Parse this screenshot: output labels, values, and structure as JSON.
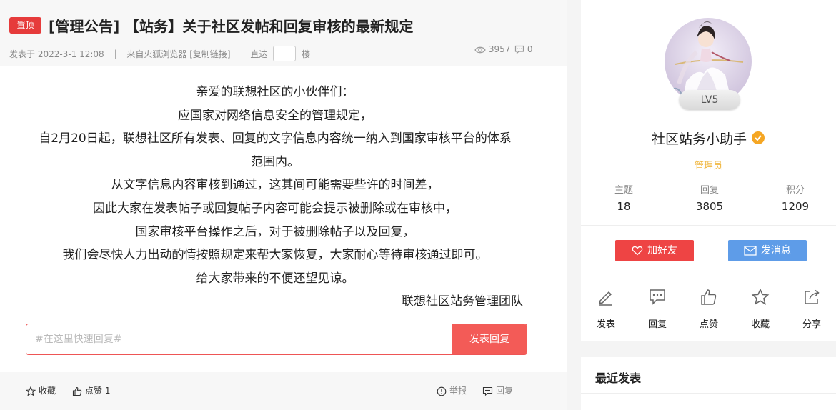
{
  "post": {
    "pin_label": "置顶",
    "title": "[管理公告] 【站务】关于社区发帖和回复审核的最新规定",
    "posted_at": "发表于 2022-3-1 12:08",
    "source": "来自火狐浏览器 [复制链接]",
    "jump_prefix": "直达",
    "jump_suffix": "楼",
    "views": "3957",
    "comments": "0",
    "body_lines": [
      "亲爱的联想社区的小伙伴们：",
      "应国家对网络信息安全的管理规定，",
      "自2月20日起，联想社区所有发表、回复的文字信息内容统一纳入到国家审核平台的体系",
      "范围内。",
      "从文字信息内容审核到通过，这其间可能需要些许的时间差，",
      "因此大家在发表帖子或回复帖子内容可能会提示被删除或在审核中，",
      "国家审核平台操作之后，对于被删除帖子以及回复，",
      "我们会尽快人力出动酌情按照规定来帮大家恢复，大家耐心等待审核通过即可。",
      "给大家带来的不便还望见谅。"
    ],
    "signature": "联想社区站务管理团队"
  },
  "reply": {
    "placeholder": "#在这里快速回复#",
    "button": "发表回复"
  },
  "footer": {
    "collect": "收藏",
    "like": "点赞 1",
    "report": "举报",
    "reply": "回复"
  },
  "profile": {
    "level": "LV5",
    "name": "社区站务小助手",
    "role": "管理员",
    "stats": [
      {
        "label": "主题",
        "value": "18"
      },
      {
        "label": "回复",
        "value": "3805"
      },
      {
        "label": "积分",
        "value": "1209"
      }
    ],
    "add_friend": "加好友",
    "send_message": "发消息"
  },
  "actions": [
    {
      "label": "发表",
      "icon": "edit-icon"
    },
    {
      "label": "回复",
      "icon": "comment-icon"
    },
    {
      "label": "点赞",
      "icon": "thumbs-up-icon"
    },
    {
      "label": "收藏",
      "icon": "star-icon"
    },
    {
      "label": "分享",
      "icon": "share-icon"
    }
  ],
  "recent": {
    "title": "最近发表"
  },
  "colors": {
    "accent_red": "#f35b57",
    "pin_red": "#e63b3b",
    "message_blue": "#5e9ce8",
    "admin_gold": "#f0b740"
  }
}
